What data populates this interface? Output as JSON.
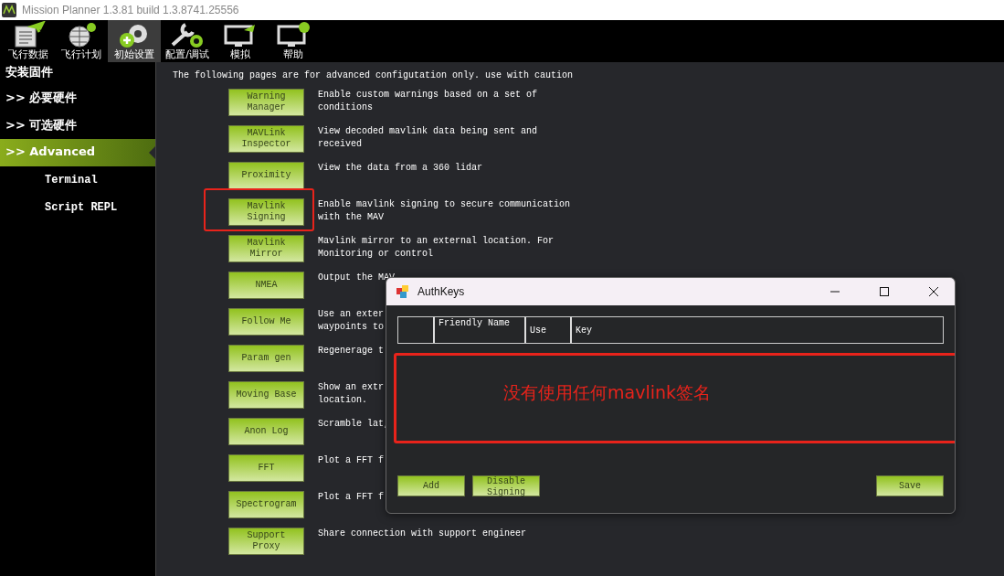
{
  "window": {
    "title": "Mission Planner 1.3.81 build 1.3.8741.25556"
  },
  "toolbar": [
    {
      "label": "飞行数据",
      "kind": "data",
      "selected": false
    },
    {
      "label": "飞行计划",
      "kind": "plan",
      "selected": false
    },
    {
      "label": "初始设置",
      "kind": "setup",
      "selected": true
    },
    {
      "label": "配置/调试",
      "kind": "config",
      "selected": false
    },
    {
      "label": "模拟",
      "kind": "sim",
      "selected": false
    },
    {
      "label": "帮助",
      "kind": "help",
      "selected": false
    }
  ],
  "sidebar": {
    "title": "安装固件",
    "items": [
      {
        "marker": ">>",
        "label": "必要硬件",
        "selected": false
      },
      {
        "marker": ">>",
        "label": "可选硬件",
        "selected": false
      },
      {
        "marker": ">>",
        "label": "Advanced",
        "selected": true,
        "children": [
          {
            "label": "Terminal"
          },
          {
            "label": "Script REPL"
          }
        ]
      }
    ]
  },
  "content": {
    "intro": "The following pages are for advanced configutation only. use with caution",
    "pages": [
      {
        "button": "Warning Manager",
        "description": "Enable custom warnings based on a set of\nconditions",
        "highlighted": false
      },
      {
        "button": "MAVLink Inspector",
        "description": "View decoded mavlink data being sent and\nreceived",
        "highlighted": false
      },
      {
        "button": "Proximity",
        "description": "View the data from a 360 lidar",
        "highlighted": false
      },
      {
        "button": "Mavlink Signing",
        "description": "Enable mavlink signing to secure communication\nwith the MAV",
        "highlighted": true
      },
      {
        "button": "Mavlink Mirror",
        "description": "Mavlink mirror to an external location. For\nMonitoring or control",
        "highlighted": false
      },
      {
        "button": "NMEA",
        "description": "Output the MAV",
        "highlighted": false
      },
      {
        "button": "Follow Me",
        "description": "Use an exter\nwaypoints to",
        "highlighted": false
      },
      {
        "button": "Param gen",
        "description": "Regenerage t",
        "highlighted": false
      },
      {
        "button": "Moving Base",
        "description": "Show an extr\nlocation.",
        "highlighted": false
      },
      {
        "button": "Anon Log",
        "description": "Scramble lat,",
        "highlighted": false
      },
      {
        "button": "FFT",
        "description": "Plot a FFT f",
        "highlighted": false
      },
      {
        "button": "Spectrogram",
        "description": "Plot a FFT f",
        "highlighted": false
      },
      {
        "button": "Support Proxy",
        "description": "Share connection with support engineer",
        "highlighted": false
      }
    ]
  },
  "dialog": {
    "title": "AuthKeys",
    "columns": [
      "Friendly Name",
      "Use",
      "Key"
    ],
    "annotation": "没有使用任何mavlink签名",
    "buttons": [
      "Add",
      "Disable Signing",
      "Save"
    ]
  }
}
